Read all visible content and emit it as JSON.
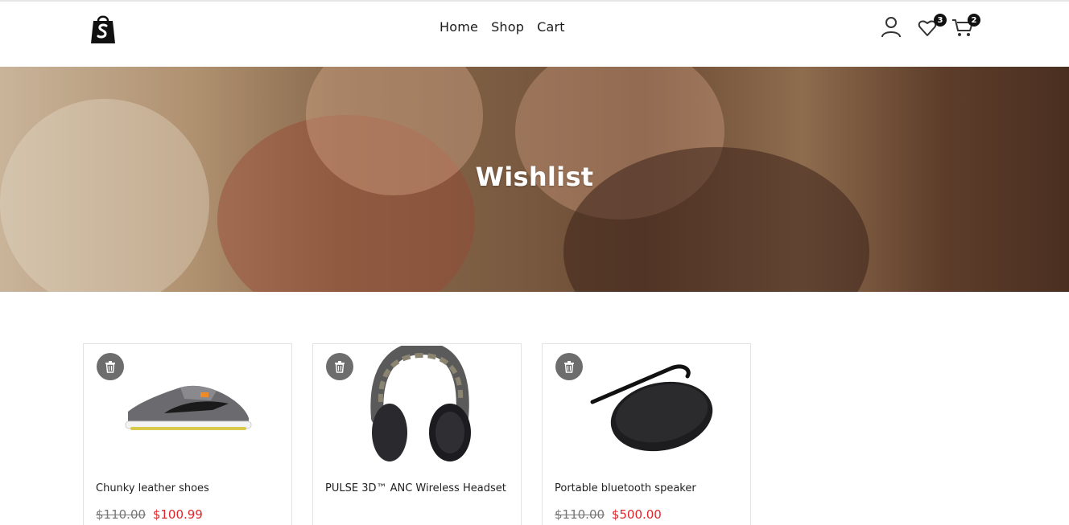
{
  "header": {
    "nav": [
      "Home",
      "Shop",
      "Cart"
    ],
    "wishlist_count": "3",
    "cart_count": "2"
  },
  "hero": {
    "title": "Wishlist"
  },
  "products": [
    {
      "name": "Chunky leather shoes",
      "old_price": "$110.00",
      "new_price": "$100.99",
      "image_icon": "shoe-image"
    },
    {
      "name": "PULSE 3D™ ANC Wireless Headset",
      "old_price": "",
      "new_price": "",
      "image_icon": "headset-image"
    },
    {
      "name": "Portable bluetooth speaker",
      "old_price": "$110.00",
      "new_price": "$500.00",
      "image_icon": "speaker-image"
    }
  ],
  "colors": {
    "sale_price": "#e0262d",
    "trash_button": "#6d6d6d"
  }
}
